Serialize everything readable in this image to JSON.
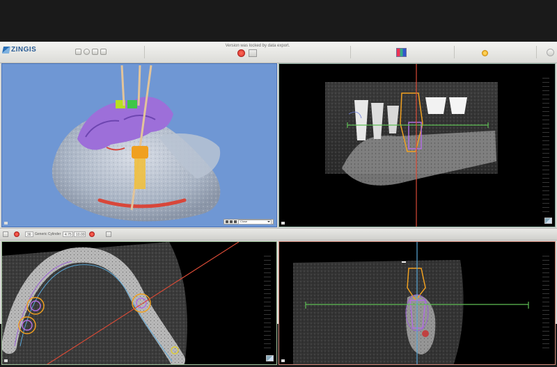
{
  "app": {
    "logo_text": "ZINGIS",
    "logo_sub": "",
    "notice": "Version was locked by data export."
  },
  "midbar": {
    "implant_id": "36",
    "implant_name": "Generic Cylinder",
    "diameter": "4.75",
    "length": "10.00"
  },
  "view_control": {
    "selected": "Close"
  },
  "colors": {
    "toolbar_bg": "#e6e6e3",
    "viewport_3d_bg": "#6f97d4",
    "panoramic_border": "#8fb0a2",
    "axial_border": "#9fc09a",
    "cross_border": "#d58a7a",
    "implant_orange": "#f0a020",
    "nerve_red": "#d8463a",
    "guide_green": "#5fbf55",
    "crosshair_red": "#d84a36",
    "crosshair_blue": "#5aa8d8",
    "plan_purple": "#9b5fd6"
  },
  "icons": [
    "grid-icon",
    "info-icon",
    "record-icon",
    "settings-icon",
    "lock-icon",
    "image-icon",
    "chart-icon",
    "sun-icon",
    "power-icon"
  ]
}
